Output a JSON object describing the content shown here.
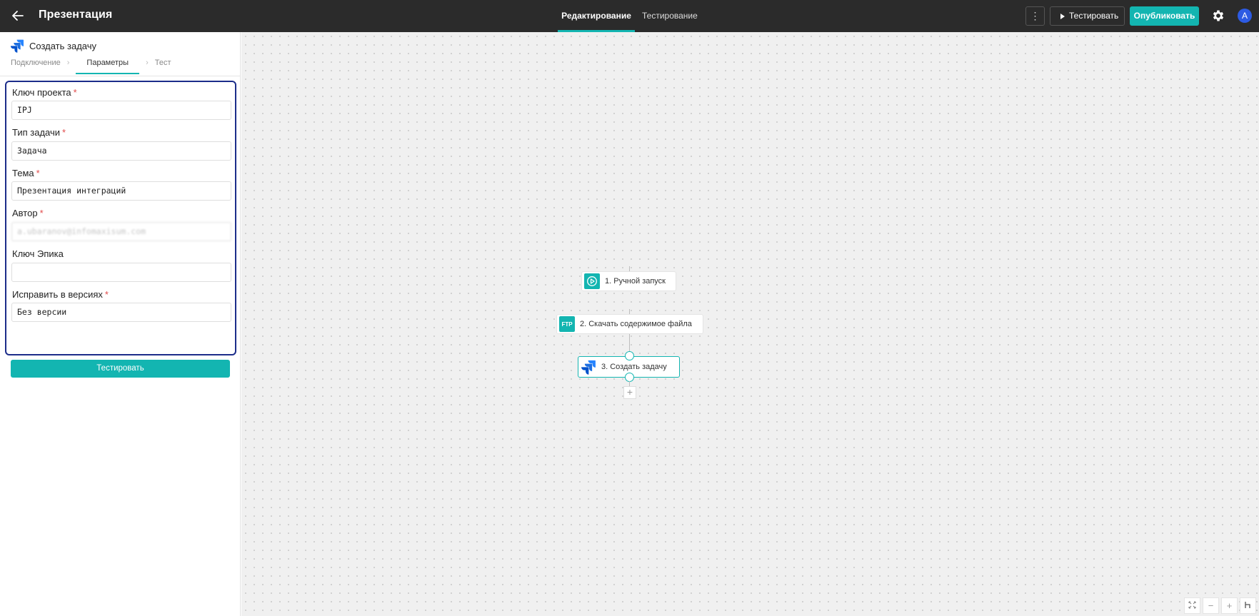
{
  "header": {
    "back_icon": "arrow-left-icon",
    "title": "Презентация",
    "tabs": [
      {
        "label": "Редактирование",
        "active": true
      },
      {
        "label": "Тестирование",
        "active": false
      }
    ],
    "more_icon": "more-vertical-icon",
    "test_label": "Тестировать",
    "publish_label": "Опубликовать",
    "settings_icon": "gear-icon",
    "avatar_initial": "A"
  },
  "colors": {
    "accent": "#13b5b1",
    "topbar": "#2b2b2b",
    "highlight_border": "#1c2d8a",
    "required": "#e24c4c",
    "avatar": "#2d5be3"
  },
  "panel": {
    "icon": "jira-icon",
    "title": "Создать задачу",
    "steps": [
      "Подключение",
      "Параметры",
      "Тест"
    ],
    "active_step": "Параметры",
    "fields": [
      {
        "label": "Ключ проекта",
        "required": true,
        "value": "IPJ"
      },
      {
        "label": "Тип задачи",
        "required": true,
        "value": "Задача"
      },
      {
        "label": "Тема",
        "required": true,
        "value": "Презентация интеграций"
      },
      {
        "label": "Автор",
        "required": true,
        "value": "a.ubaranov@infomaxisum.com"
      },
      {
        "label": "Ключ Эпика",
        "required": false,
        "value": ""
      },
      {
        "label": "Исправить в версиях",
        "required": true,
        "value": "Без версии"
      }
    ],
    "required_mark": "*",
    "test_button": "Тестировать"
  },
  "canvas": {
    "nodes": [
      {
        "label": "1. Ручной запуск",
        "icon": "play-circle-icon"
      },
      {
        "label": "2. Скачать содержимое файла",
        "icon": "ftp-icon",
        "icon_text": "FTP"
      },
      {
        "label": "3. Создать задачу",
        "icon": "jira-icon",
        "selected": true
      }
    ],
    "add_symbol": "+",
    "zoom_controls": [
      "fit-screen-icon",
      "zoom-out-icon",
      "zoom-in-icon",
      "layout-icon"
    ]
  }
}
